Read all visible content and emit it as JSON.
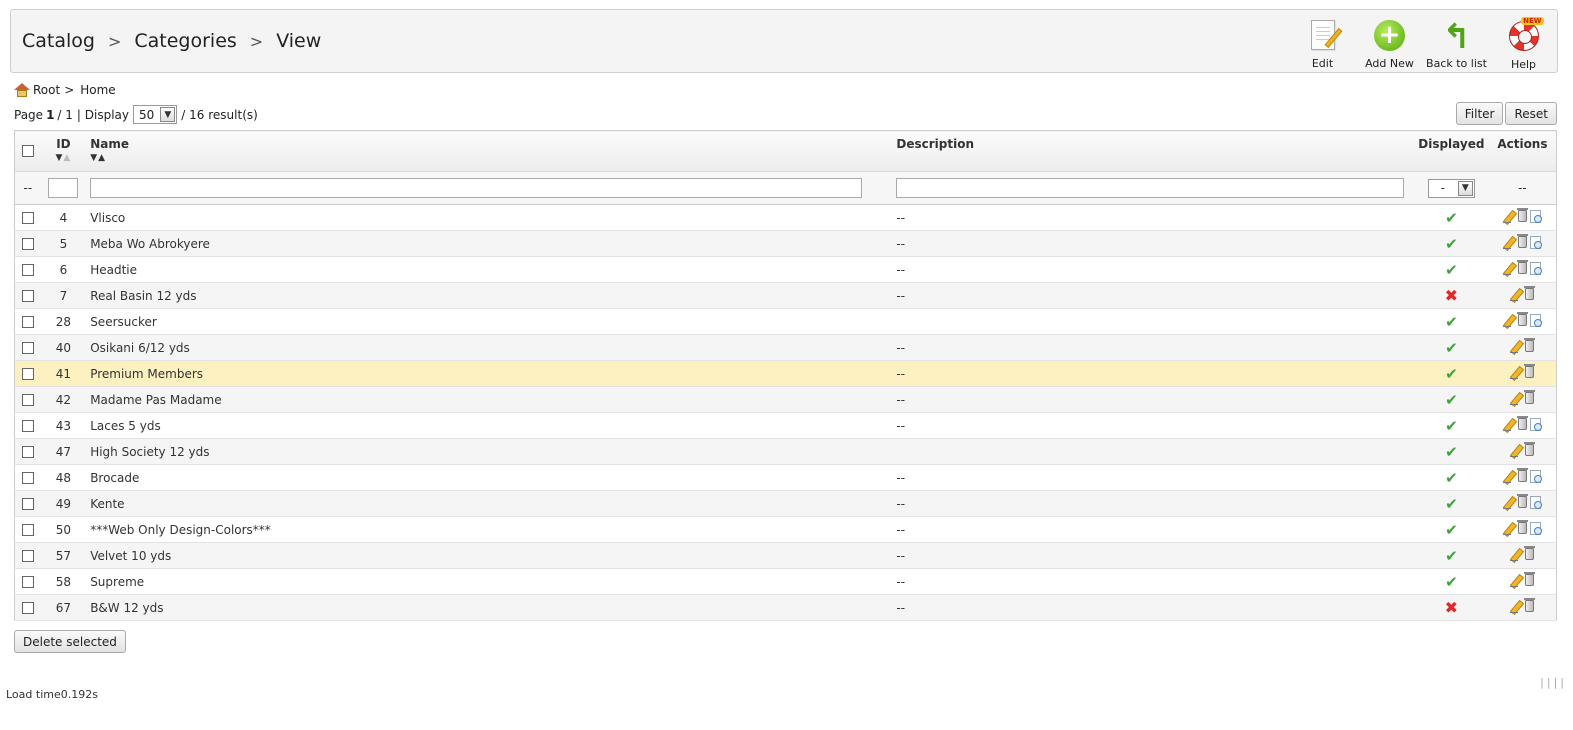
{
  "breadcrumb": [
    "Catalog",
    "Categories",
    "View"
  ],
  "toolbar": [
    {
      "label": "Edit",
      "icon": "edit-icon"
    },
    {
      "label": "Add New",
      "icon": "add-new-icon"
    },
    {
      "label": "Back to list",
      "icon": "back-arrow-icon"
    },
    {
      "label": "Help",
      "icon": "help-lifebuoy-icon"
    }
  ],
  "path": {
    "root": "Root",
    "sep": ">",
    "home": "Home"
  },
  "pagination": {
    "page_label": "Page",
    "current": "1",
    "total": "/ 1",
    "display_label": "| Display",
    "per_page": "50",
    "results": "/ 16 result(s)"
  },
  "filter_buttons": {
    "filter": "Filter",
    "reset": "Reset"
  },
  "columns": {
    "id": "ID",
    "name": "Name",
    "description": "Description",
    "displayed": "Displayed",
    "actions": "Actions"
  },
  "filters": {
    "cb_placeholder": "--",
    "displayed_value": "-",
    "actions_placeholder": "--"
  },
  "rows": [
    {
      "id": "4",
      "name": "Vlisco",
      "description": "--",
      "displayed": true,
      "actions": [
        "edit",
        "delete",
        "view"
      ]
    },
    {
      "id": "5",
      "name": "Meba Wo Abrokyere",
      "description": "--",
      "displayed": true,
      "actions": [
        "edit",
        "delete",
        "view"
      ]
    },
    {
      "id": "6",
      "name": "Headtie",
      "description": "--",
      "displayed": true,
      "actions": [
        "edit",
        "delete",
        "view"
      ]
    },
    {
      "id": "7",
      "name": "Real Basin 12 yds",
      "description": "--",
      "displayed": false,
      "actions": [
        "edit",
        "delete"
      ]
    },
    {
      "id": "28",
      "name": "Seersucker",
      "description": "",
      "displayed": true,
      "actions": [
        "edit",
        "delete",
        "view"
      ]
    },
    {
      "id": "40",
      "name": "Osikani 6/12 yds",
      "description": "--",
      "displayed": true,
      "actions": [
        "edit",
        "delete"
      ]
    },
    {
      "id": "41",
      "name": "Premium Members",
      "description": "--",
      "displayed": true,
      "actions": [
        "edit",
        "delete"
      ],
      "highlight": true
    },
    {
      "id": "42",
      "name": "Madame Pas Madame",
      "description": "--",
      "displayed": true,
      "actions": [
        "edit",
        "delete"
      ]
    },
    {
      "id": "43",
      "name": "Laces 5 yds",
      "description": "--",
      "displayed": true,
      "actions": [
        "edit",
        "delete",
        "view"
      ]
    },
    {
      "id": "47",
      "name": "High Society 12 yds",
      "description": "",
      "displayed": true,
      "actions": [
        "edit",
        "delete"
      ]
    },
    {
      "id": "48",
      "name": "Brocade",
      "description": "--",
      "displayed": true,
      "actions": [
        "edit",
        "delete",
        "view"
      ]
    },
    {
      "id": "49",
      "name": "Kente",
      "description": "--",
      "displayed": true,
      "actions": [
        "edit",
        "delete",
        "view"
      ]
    },
    {
      "id": "50",
      "name": "***Web Only Design-Colors***",
      "description": "--",
      "displayed": true,
      "actions": [
        "edit",
        "delete",
        "view"
      ]
    },
    {
      "id": "57",
      "name": "Velvet 10 yds",
      "description": "--",
      "displayed": true,
      "actions": [
        "edit",
        "delete"
      ]
    },
    {
      "id": "58",
      "name": "Supreme",
      "description": "--",
      "displayed": true,
      "actions": [
        "edit",
        "delete"
      ]
    },
    {
      "id": "67",
      "name": "B&W 12 yds",
      "description": "--",
      "displayed": false,
      "actions": [
        "edit",
        "delete"
      ]
    }
  ],
  "delete_selected": "Delete selected",
  "footer": {
    "load_time": "Load time0.192s"
  },
  "colors": {
    "highlight_row": "#fdf0c1",
    "check": "#3fa33a",
    "cross": "#e02a2a"
  }
}
